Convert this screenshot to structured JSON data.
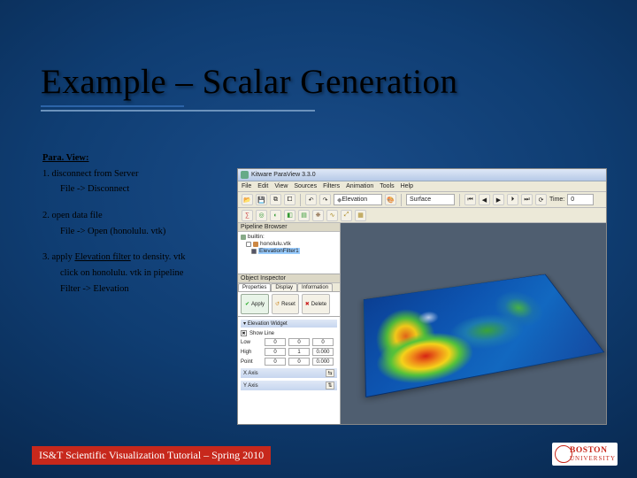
{
  "slide": {
    "title": "Example – Scalar Generation",
    "section_head": "Para. View:",
    "steps": {
      "s1": "1. disconnect from Server",
      "s1a": "File -> Disconnect",
      "s2": "2. open data file",
      "s2a": "File -> Open (honolulu. vtk)",
      "s3_pre": "3. apply ",
      "s3_u": "Elevation filter",
      "s3_post": " to density. vtk",
      "s3a": "click on honolulu. vtk in pipeline",
      "s3b": "Filter -> Elevation"
    },
    "footer": "IS&T Scientific Visualization Tutorial – Spring 2010",
    "logo": {
      "line1": "BOSTON",
      "line2": "UNIVERSITY"
    }
  },
  "app": {
    "title": "Kitware ParaView 3.3.0",
    "menus": [
      "File",
      "Edit",
      "View",
      "Sources",
      "Filters",
      "Animation",
      "Tools",
      "Help"
    ],
    "toolbar": {
      "active_field": "Elevation",
      "repr": "Surface",
      "time_label": "Time:",
      "time_val": "0"
    },
    "pipeline": {
      "title": "Pipeline Browser",
      "items": [
        {
          "label": "builtin:"
        },
        {
          "label": "honolulu.vtk"
        },
        {
          "label": "ElevationFilter1",
          "selected": true
        }
      ]
    },
    "inspector": {
      "title": "Object Inspector",
      "tabs": [
        "Properties",
        "Display",
        "Information"
      ],
      "apply": "Apply",
      "reset": "Reset",
      "delete": "Delete"
    },
    "elevation": {
      "section": "Elevation Widget",
      "show_line": "Show Line",
      "low_label": "Low",
      "low": [
        "0",
        "0",
        "0"
      ],
      "high_label": "High",
      "high": [
        "0",
        "1",
        "0.000"
      ],
      "point_label": "Point",
      "point": [
        "0",
        "0",
        "0.000"
      ],
      "xaxis": "X Axis",
      "yaxis": "Y Axis"
    }
  }
}
